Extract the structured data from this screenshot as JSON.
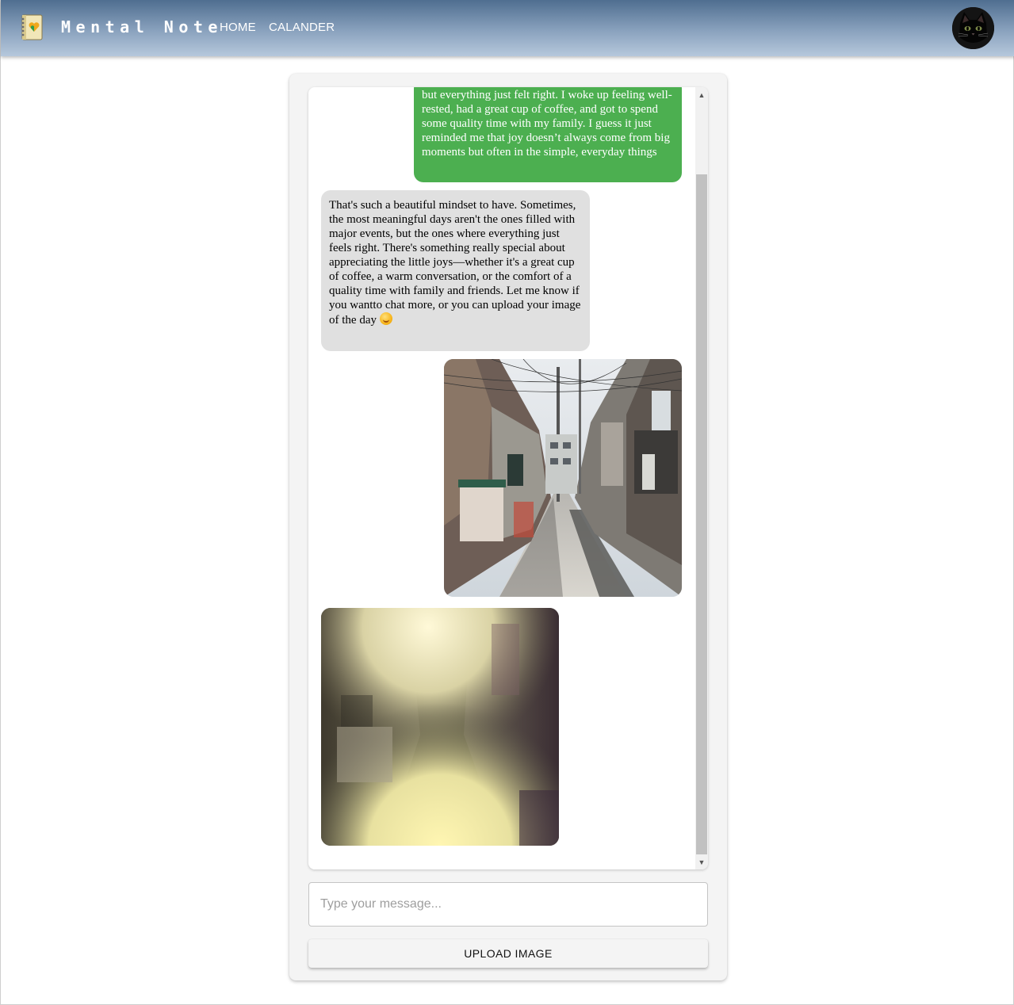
{
  "header": {
    "logo_icon": "notebook-heart-icon",
    "brand": "Mental Note",
    "nav": [
      {
        "label": "HOME"
      },
      {
        "label": "CALANDER"
      }
    ],
    "avatar_icon": "black-cat-avatar"
  },
  "chat": {
    "messages": [
      {
        "sender": "user",
        "type": "text",
        "text": "but everything just felt right. I woke up feeling well-rested, had a great cup of coffee, and got to spend some quality time with my family. I guess it just reminded me that joy doesn’t always come from big moments but often in the simple, everyday things"
      },
      {
        "sender": "bot",
        "type": "text",
        "text": "That's such a beautiful mindset to have. Sometimes, the most meaningful days aren't the ones filled with major events, but the ones where everything just feels right. There's something really special about appreciating the little joys—whether it's a great cup of coffee, a warm conversation, or the comfort of a quality time with family and friends. Let me know if you wantto chat more, or you can upload your image of the day",
        "emoji": "smiling-face-icon"
      },
      {
        "sender": "user",
        "type": "image",
        "image": "narrow-street-alley-photo"
      },
      {
        "sender": "bot",
        "type": "image",
        "image": "blurred-alley-generated-image"
      }
    ],
    "input_placeholder": "Type your message...",
    "input_value": "",
    "upload_label": "UPLOAD IMAGE"
  },
  "colors": {
    "user_bubble": "#4caf50",
    "bot_bubble": "#e0e0e0",
    "header_top": "#4f6e90",
    "header_bottom": "#b6c8dc"
  }
}
